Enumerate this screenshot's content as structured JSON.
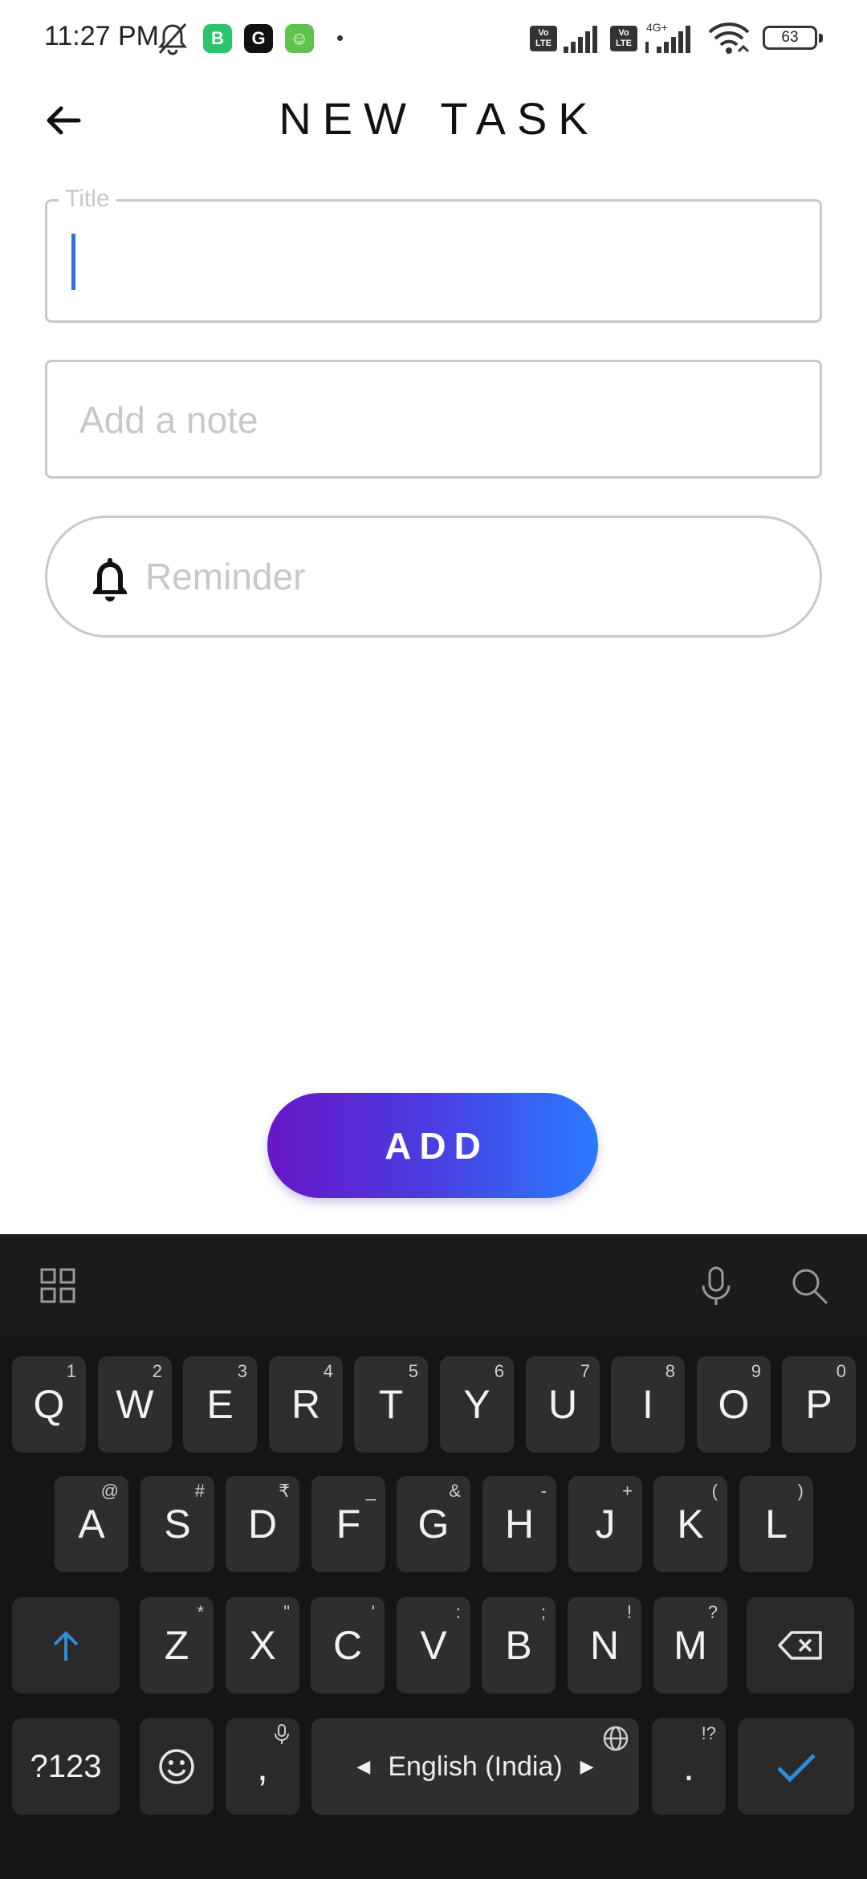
{
  "status_bar": {
    "time": "11:27 PM",
    "battery": "63",
    "network": "4G+",
    "volte": "Vo LTE"
  },
  "header": {
    "title": "NEW TASK",
    "back_icon": "arrow-left-icon"
  },
  "form": {
    "title_label": "Title",
    "title_value": "",
    "note_placeholder": "Add a note",
    "reminder_label": "Reminder",
    "reminder_icon": "bell-icon"
  },
  "actions": {
    "add_label": "ADD"
  },
  "colors": {
    "accent_start": "#6716c8",
    "accent_end": "#2a7bff",
    "caret": "#2f6fe0",
    "field_border": "#c8c8c8",
    "keyboard_bg": "#151515",
    "key_bg": "#2e2e2e"
  },
  "keyboard": {
    "row1": [
      {
        "k": "Q",
        "h": "1"
      },
      {
        "k": "W",
        "h": "2"
      },
      {
        "k": "E",
        "h": "3"
      },
      {
        "k": "R",
        "h": "4"
      },
      {
        "k": "T",
        "h": "5"
      },
      {
        "k": "Y",
        "h": "6"
      },
      {
        "k": "U",
        "h": "7"
      },
      {
        "k": "I",
        "h": "8"
      },
      {
        "k": "O",
        "h": "9"
      },
      {
        "k": "P",
        "h": "0"
      }
    ],
    "row2": [
      {
        "k": "A",
        "h": "@"
      },
      {
        "k": "S",
        "h": "#"
      },
      {
        "k": "D",
        "h": "₹"
      },
      {
        "k": "F",
        "h": "_"
      },
      {
        "k": "G",
        "h": "&"
      },
      {
        "k": "H",
        "h": "-"
      },
      {
        "k": "J",
        "h": "+"
      },
      {
        "k": "K",
        "h": "("
      },
      {
        "k": "L",
        "h": ")"
      }
    ],
    "row3": [
      {
        "k": "Z",
        "h": "*"
      },
      {
        "k": "X",
        "h": "\""
      },
      {
        "k": "C",
        "h": "'"
      },
      {
        "k": "V",
        "h": ":"
      },
      {
        "k": "B",
        "h": ";"
      },
      {
        "k": "N",
        "h": "!"
      },
      {
        "k": "M",
        "h": "?"
      }
    ],
    "symbols_label": "?123",
    "comma_label": ",",
    "period_label": ".",
    "period_hint": "!?",
    "space_label": "English (India)"
  }
}
